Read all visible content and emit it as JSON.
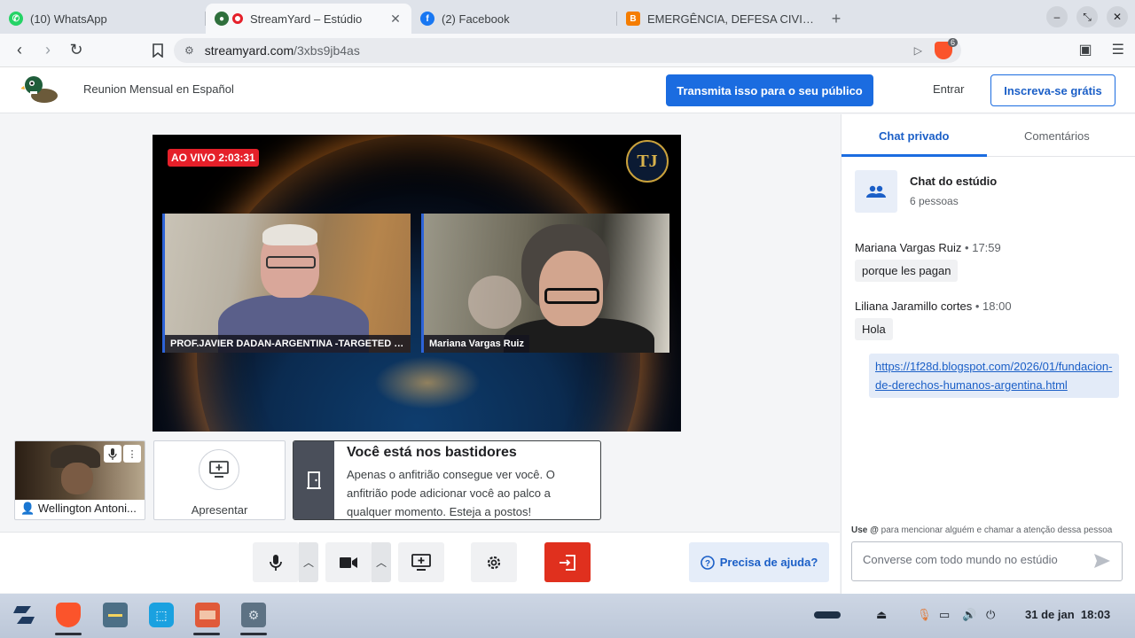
{
  "browser": {
    "tabs": [
      {
        "title": "(10) WhatsApp",
        "icon": "whatsapp-icon",
        "color": "#25d366",
        "active": false
      },
      {
        "title": "StreamYard – Estúdio",
        "icon": "streamyard-icon",
        "color": "#e5202a",
        "active": true
      },
      {
        "title": "(2) Facebook",
        "icon": "facebook-icon",
        "color": "#1877f2",
        "active": false
      },
      {
        "title": "EMERGÊNCIA, DEFESA CIVIL, A",
        "icon": "blogger-icon",
        "color": "#f57d00",
        "active": false
      }
    ],
    "url_domain": "streamyard.com",
    "url_path": "/3xbs9jb4as",
    "shields_count": "6"
  },
  "header": {
    "studio_name": "Reunion Mensual en Español",
    "broadcast_button": "Transmita isso para o seu público",
    "enter_button": "Entrar",
    "signup_button": "Inscreva-se grátis"
  },
  "stage": {
    "live_label": "AO VIVO 2:03:31",
    "participants": [
      {
        "name": "PROF.JAVIER DADAN-ARGENTINA -TARGETED JUSTICE..."
      },
      {
        "name": "Mariana Vargas Ruiz"
      }
    ]
  },
  "backstage": {
    "self_name": "Wellington Antoni...",
    "present_label": "Apresentar",
    "title": "Você está nos bastidores",
    "text": "Apenas o anfitrião consegue ver você. O anfitrião pode adicionar você ao palco a qualquer momento. Esteja a postos!"
  },
  "controls": {
    "help_label": "Precisa de ajuda?"
  },
  "chat": {
    "tab_private": "Chat privado",
    "tab_comments": "Comentários",
    "studio_title": "Chat do estúdio",
    "studio_count": "6 pessoas",
    "messages": [
      {
        "author": "Mariana Vargas Ruiz",
        "time": "17:59",
        "text": "porque les pagan"
      },
      {
        "author": "Liliana Jaramillo cortes",
        "time": "18:00",
        "text": "Hola"
      }
    ],
    "link": "https://1f28d.blogspot.com/2026/01/fundacion-de-derechos-humanos-argentina.html",
    "mention_hint_key": "Use @",
    "mention_hint": "para mencionar alguém e chamar a atenção dessa pessoa",
    "input_placeholder": "Converse com todo mundo no estúdio"
  },
  "taskbar": {
    "date": "31 de jan",
    "time": "18:03"
  },
  "colors": {
    "primary_blue": "#1b6ce0",
    "live_red": "#e5202a",
    "leave_red": "#e0301e"
  }
}
